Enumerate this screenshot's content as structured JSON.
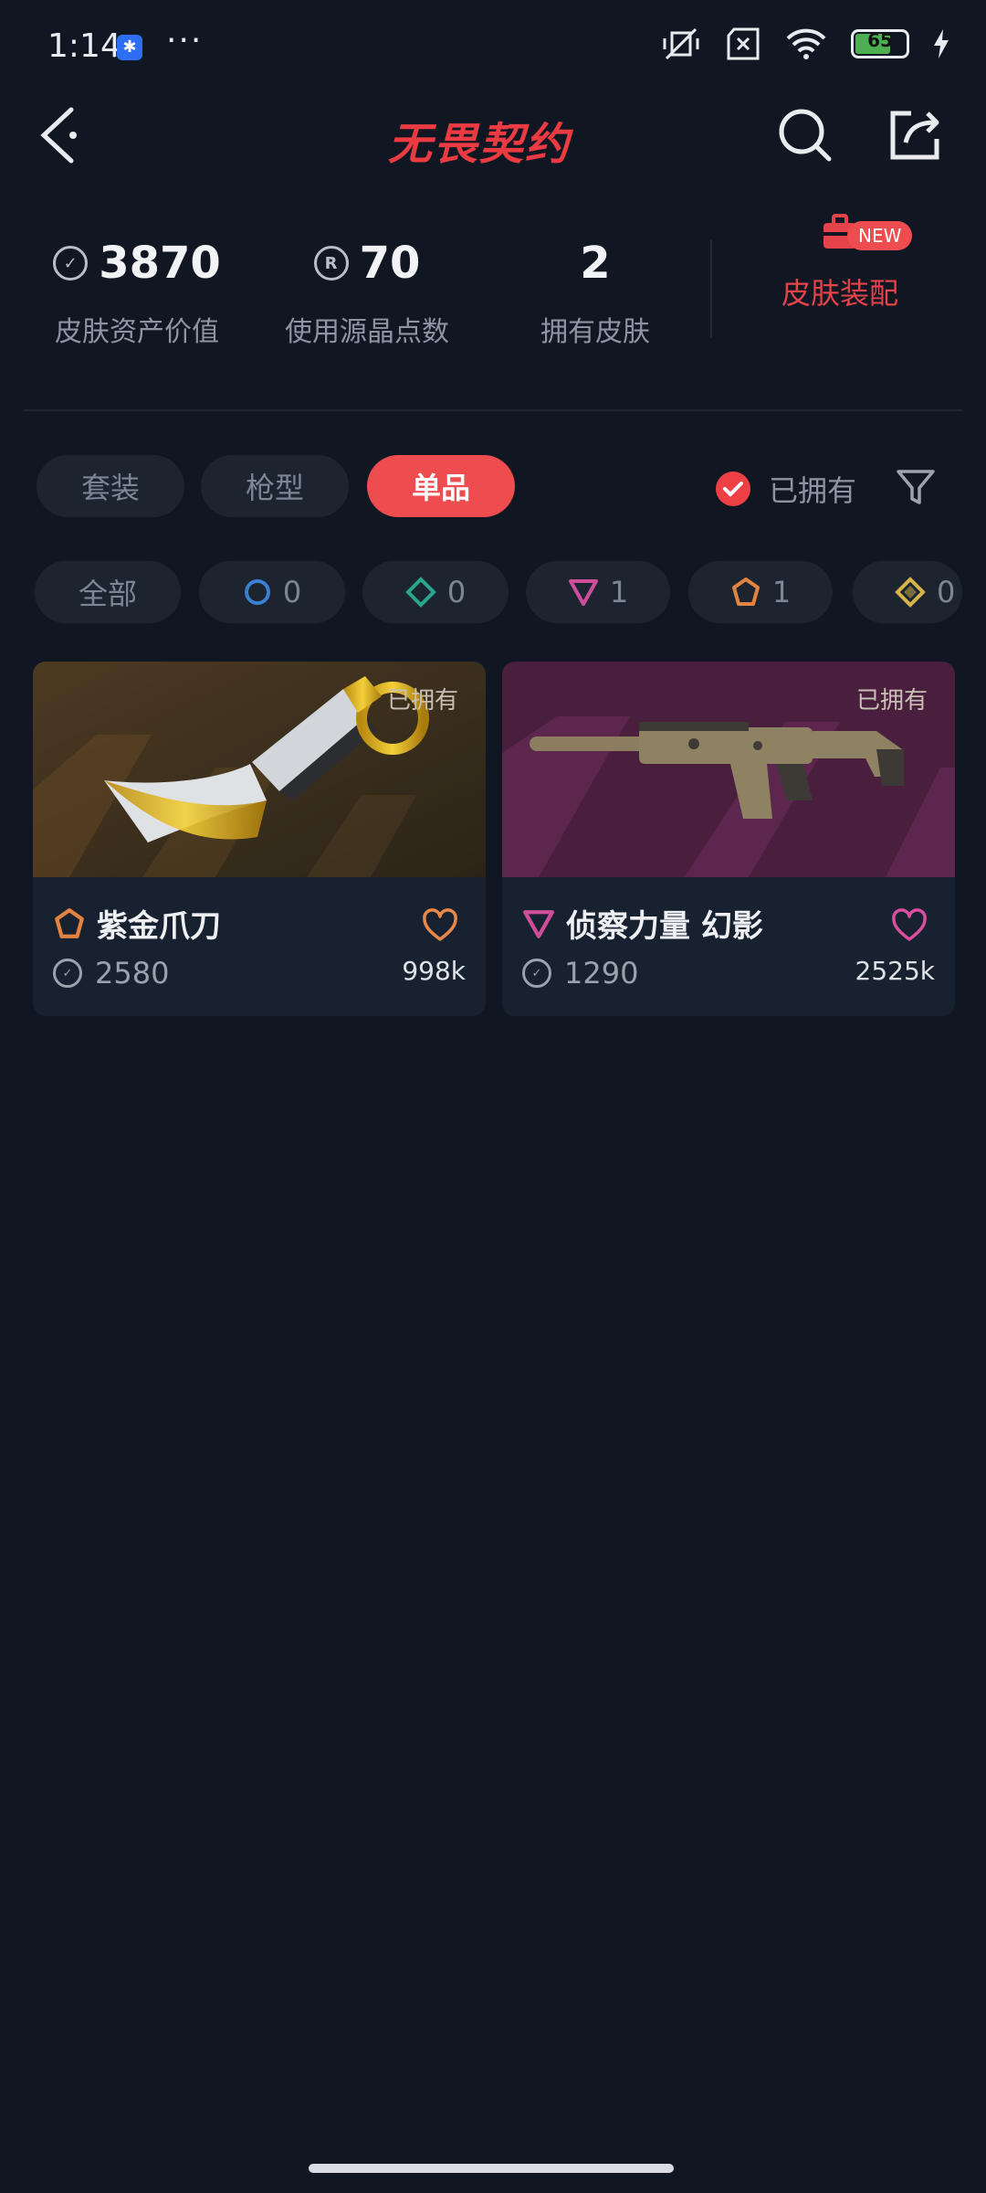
{
  "status_bar": {
    "time": "1:14",
    "more": "···",
    "battery": "65"
  },
  "header": {
    "title": "无畏契约"
  },
  "stats": [
    {
      "value": "3870",
      "label": "皮肤资产价值",
      "icon": "vp-icon"
    },
    {
      "value": "70",
      "label": "使用源晶点数",
      "icon": "radianite-icon"
    },
    {
      "value": "2",
      "label": "拥有皮肤"
    }
  ],
  "equip": {
    "label": "皮肤装配",
    "badge": "NEW"
  },
  "tabs": [
    {
      "label": "套装",
      "active": false
    },
    {
      "label": "枪型",
      "active": false
    },
    {
      "label": "单品",
      "active": true
    }
  ],
  "owned_filter": {
    "label": "已拥有",
    "checked": true
  },
  "rarity_chips": [
    {
      "label": "全部",
      "count": ""
    },
    {
      "label": "",
      "count": "0",
      "color": "#3a7fd1",
      "icon": "circle-tier-icon"
    },
    {
      "label": "",
      "count": "0",
      "color": "#2aa58e",
      "icon": "diamond-tier-icon"
    },
    {
      "label": "",
      "count": "1",
      "color": "#cf4e9b",
      "icon": "triangle-tier-icon"
    },
    {
      "label": "",
      "count": "1",
      "color": "#e2843f",
      "icon": "pentagon-tier-icon"
    },
    {
      "label": "",
      "count": "0",
      "color": "#d6b44a",
      "icon": "rhombus-tier-icon"
    }
  ],
  "items": [
    {
      "name": "紫金爪刀",
      "price": "2580",
      "likes": "998k",
      "tag": "已拥有",
      "tier_color": "#e2843f",
      "tier_icon": "pentagon-tier-icon",
      "heart_color": "#e8894a"
    },
    {
      "name": "侦察力量 幻影",
      "price": "1290",
      "likes": "2525k",
      "tag": "已拥有",
      "tier_color": "#cf4e9b",
      "tier_icon": "triangle-tier-icon",
      "heart_color": "#d74f9e"
    }
  ]
}
